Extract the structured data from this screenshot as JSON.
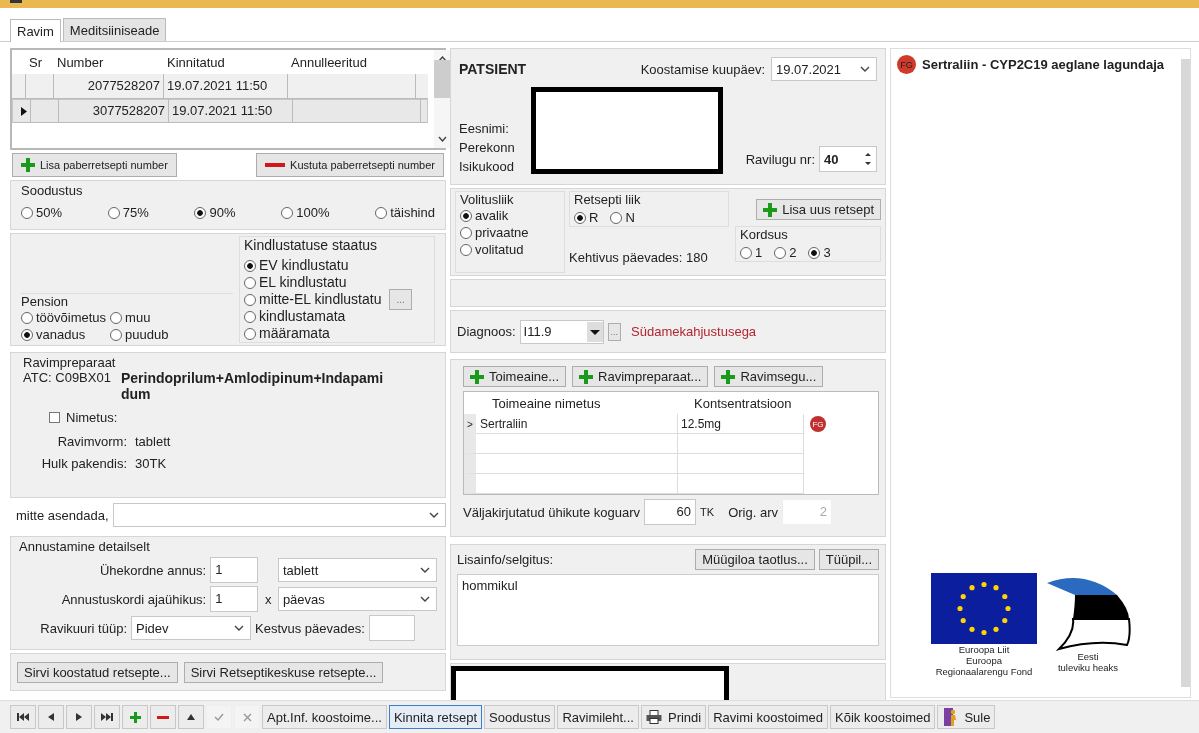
{
  "tabs": [
    {
      "label": "Ravim",
      "selected": true
    },
    {
      "label": "Meditsiiniseade",
      "selected": false
    }
  ],
  "paper_prescriptions": {
    "columns": [
      "Sr",
      "Number",
      "Kinnitatud",
      "Annulleeritud"
    ],
    "rows": [
      {
        "selected": false,
        "number": "2077528207",
        "confirmed": "19.07.2021 11:50"
      },
      {
        "selected": true,
        "number": "3077528207",
        "confirmed": "19.07.2021 11:50"
      }
    ],
    "buttons": [
      {
        "kind": "add",
        "label": "Lisa paberretsepti number"
      },
      {
        "kind": "remove",
        "label": "Kustuta paberretsepti number"
      }
    ]
  },
  "soodustus": {
    "title": "Soodustus",
    "options": [
      {
        "label": "50%",
        "selected": false
      },
      {
        "label": "75%",
        "selected": false
      },
      {
        "label": "90%",
        "selected": true
      },
      {
        "label": "100%",
        "selected": false
      },
      {
        "label": "täishind",
        "selected": false
      }
    ]
  },
  "pension": {
    "title": "Pension",
    "options": [
      {
        "label": "töövõimetus",
        "selected": false
      },
      {
        "label": "muu",
        "selected": false
      },
      {
        "label": "vanadus",
        "selected": true
      },
      {
        "label": "puudub",
        "selected": false
      }
    ]
  },
  "kindlustus": {
    "title": "Kindlustatuse staatus",
    "more": "...",
    "options": [
      {
        "label": "EV kindlustatu",
        "selected": true
      },
      {
        "label": "EL kindlustatu",
        "selected": false
      },
      {
        "label": "mitte-EL kindlustatu",
        "selected": false
      },
      {
        "label": "kindlustamata",
        "selected": false
      },
      {
        "label": "määramata",
        "selected": false
      }
    ]
  },
  "ravimpreparaat": {
    "title": "Ravimpreparaat",
    "atc": "ATC: C09BX01",
    "name": "Perindoprilum+Amlodipinum+Indapamidum",
    "nimetus": {
      "label": "Nimetus:",
      "checked": false
    },
    "fields": [
      {
        "label": "Ravimvorm:",
        "value": "tablett"
      },
      {
        "label": "Hulk pakendis:",
        "value": "30TK"
      }
    ]
  },
  "mitte_asendada": {
    "label": "mitte asendada,"
  },
  "annustamine": {
    "title": "Annustamine detailselt",
    "single_label": "Ühekordne annus:",
    "single": "1",
    "single_unit": "tablett",
    "times_label": "Annustuskordi ajaühikus:",
    "times": "1",
    "times_x": "x",
    "times_unit": "päevas",
    "course_label": "Ravikuuri tüüp:",
    "course": "Pidev",
    "duration_label": "Kestvus päevades:"
  },
  "browse_buttons": [
    "Sirvi koostatud retsepte...",
    "Sirvi Retseptikeskuse retsepte..."
  ],
  "patsient": {
    "title": "PATSIENT",
    "date_label": "Koostamise kuupäev:",
    "date": "19.07.2021",
    "labels": [
      "Eesnimi:",
      "Perekonn",
      "Isikukood"
    ],
    "ravilugu_label": "Ravilugu nr:",
    "ravilugu": "40"
  },
  "volitusliik": {
    "title": "Volitusliik",
    "options": [
      {
        "label": "avalik",
        "selected": true
      },
      {
        "label": "privaatne",
        "selected": false
      },
      {
        "label": "volitatud",
        "selected": false
      }
    ]
  },
  "retsepti_liik": {
    "title": "Retsepti liik",
    "options": [
      {
        "label": "R",
        "selected": true
      },
      {
        "label": "N",
        "selected": false
      }
    ]
  },
  "new_prescription": "Lisa uus retsept",
  "kehtivus": "Kehtivus päevades: 180",
  "kordsus": {
    "title": "Kordsus",
    "options": [
      {
        "label": "1",
        "selected": false
      },
      {
        "label": "2",
        "selected": false
      },
      {
        "label": "3",
        "selected": true
      }
    ]
  },
  "diagnoos": {
    "label": "Diagnoos:",
    "code": "I11.9",
    "more": "...",
    "description": "Südamekahjustusega"
  },
  "substance_buttons": [
    "Toimeaine...",
    "Ravimpreparaat...",
    "Ravimsegu..."
  ],
  "substances": {
    "columns": [
      "Toimeaine nimetus",
      "Kontsentratsioon"
    ],
    "rows": [
      {
        "indicator": ">",
        "name": "Sertraliin",
        "concentration": "12.5mg",
        "badge": "FG"
      }
    ]
  },
  "total": {
    "label": "Väljakirjutatud ühikute koguarv",
    "value": "60",
    "unit": "TK",
    "orig_label": "Orig. arv",
    "orig": "2"
  },
  "lisainfo": {
    "label": "Lisainfo/selgitus:",
    "buttons": [
      "Müügiloa taotlus...",
      "Tüüpil..."
    ],
    "text": "hommikul"
  },
  "warning": {
    "badge": "FG",
    "text": "Sertraliin - CYP2C19 aeglane lagundaja"
  },
  "logos": [
    {
      "kind": "eu",
      "lines": [
        "Euroopa Liit",
        "Euroopa",
        "Regionaalarengu Fond"
      ]
    },
    {
      "kind": "estonia",
      "lines": [
        "Eesti",
        "tuleviku heaks"
      ]
    }
  ],
  "toolbar": [
    {
      "kind": "first",
      "disabled": false,
      "focused": false
    },
    {
      "kind": "prev",
      "disabled": false,
      "focused": false
    },
    {
      "kind": "next",
      "disabled": false,
      "focused": false
    },
    {
      "kind": "last",
      "disabled": false,
      "focused": false
    },
    {
      "kind": "add",
      "disabled": false,
      "focused": false
    },
    {
      "kind": "remove",
      "disabled": false,
      "focused": false
    },
    {
      "kind": "up",
      "disabled": false,
      "focused": false
    },
    {
      "kind": "check",
      "disabled": true,
      "focused": false
    },
    {
      "kind": "cancel",
      "disabled": true,
      "focused": false
    },
    {
      "kind": "text",
      "label": "Apt.Inf. koostoime...",
      "disabled": false,
      "focused": false
    },
    {
      "kind": "text",
      "label": "Kinnita retsept",
      "disabled": false,
      "focused": true
    },
    {
      "kind": "text",
      "label": "Soodustus",
      "disabled": false,
      "focused": false
    },
    {
      "kind": "text",
      "label": "Ravimileht...",
      "disabled": false,
      "focused": false
    },
    {
      "kind": "print",
      "label": "Prindi",
      "disabled": false,
      "focused": false
    },
    {
      "kind": "text",
      "label": "Ravimi koostoimed",
      "disabled": false,
      "focused": false
    },
    {
      "kind": "text",
      "label": "Kõik koostoimed",
      "disabled": false,
      "focused": false
    },
    {
      "kind": "exit",
      "label": "Sule",
      "disabled": false,
      "focused": false
    }
  ]
}
